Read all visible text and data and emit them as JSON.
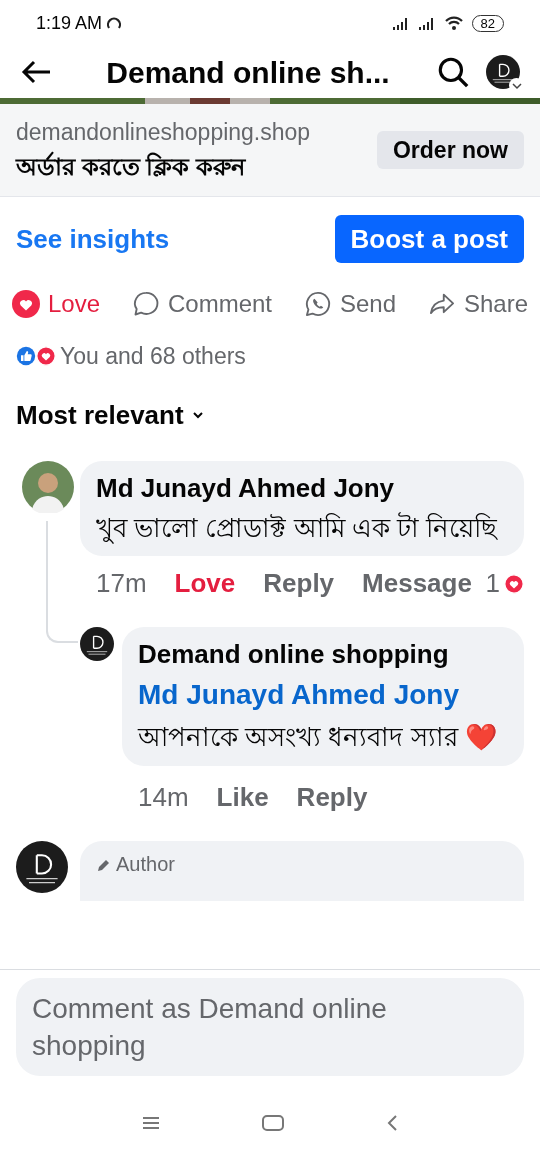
{
  "status_bar": {
    "time": "1:19 AM",
    "battery": "82"
  },
  "header": {
    "title": "Demand online sh..."
  },
  "ad_link": {
    "domain": "demandonlineshopping.shop",
    "headline": "অর্ডার করতে ক্লিক করুন",
    "button": "Order now"
  },
  "insights": {
    "link": "See insights",
    "button": "Boost a post"
  },
  "actions": [
    {
      "kind": "love",
      "label": "Love",
      "selected": true
    },
    {
      "kind": "comment",
      "label": "Comment",
      "selected": false
    },
    {
      "kind": "send",
      "label": "Send",
      "selected": false
    },
    {
      "kind": "share",
      "label": "Share",
      "selected": false
    }
  ],
  "reaction_summary": "You and 68 others",
  "sort": "Most relevant",
  "comments": [
    {
      "author": "Md Junayd Ahmed Jony",
      "text": "খুব ভালো  প্রোডাক্ট  আমি এক টা নিয়েছি",
      "time": "17m",
      "reaction": "Love",
      "reacted": true,
      "reply": "Reply",
      "message": "Message",
      "reaction_count": "1",
      "replies": [
        {
          "author": "Demand online shopping",
          "mention": "Md Junayd Ahmed Jony",
          "text": "আপনাকে অসংখ্য ধন্যবাদ স্যার ❤️",
          "time": "14m",
          "reaction": "Like",
          "reacted": false,
          "reply": "Reply"
        }
      ]
    },
    {
      "badge": "Author"
    }
  ],
  "composer": {
    "placeholder": "Comment as Demand online shopping"
  }
}
